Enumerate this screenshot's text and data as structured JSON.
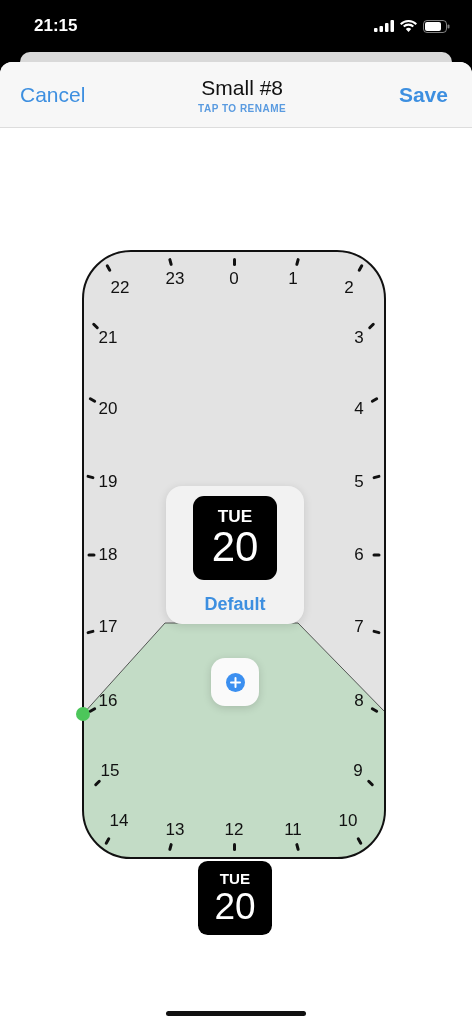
{
  "status_bar": {
    "time": "21:15"
  },
  "nav": {
    "cancel": "Cancel",
    "title": "Small #8",
    "subtitle": "TAP TO RENAME",
    "save": "Save"
  },
  "dial": {
    "hours": [
      "22",
      "23",
      "0",
      "1",
      "2",
      "21",
      "3",
      "20",
      "4",
      "19",
      "5",
      "18",
      "6",
      "17",
      "7",
      "16",
      "8",
      "15",
      "9",
      "14",
      "13",
      "12",
      "11",
      "10"
    ]
  },
  "default_card": {
    "widget": {
      "day": "TUE",
      "date": "20"
    },
    "label": "Default"
  },
  "preview_widget": {
    "day": "TUE",
    "date": "20"
  }
}
